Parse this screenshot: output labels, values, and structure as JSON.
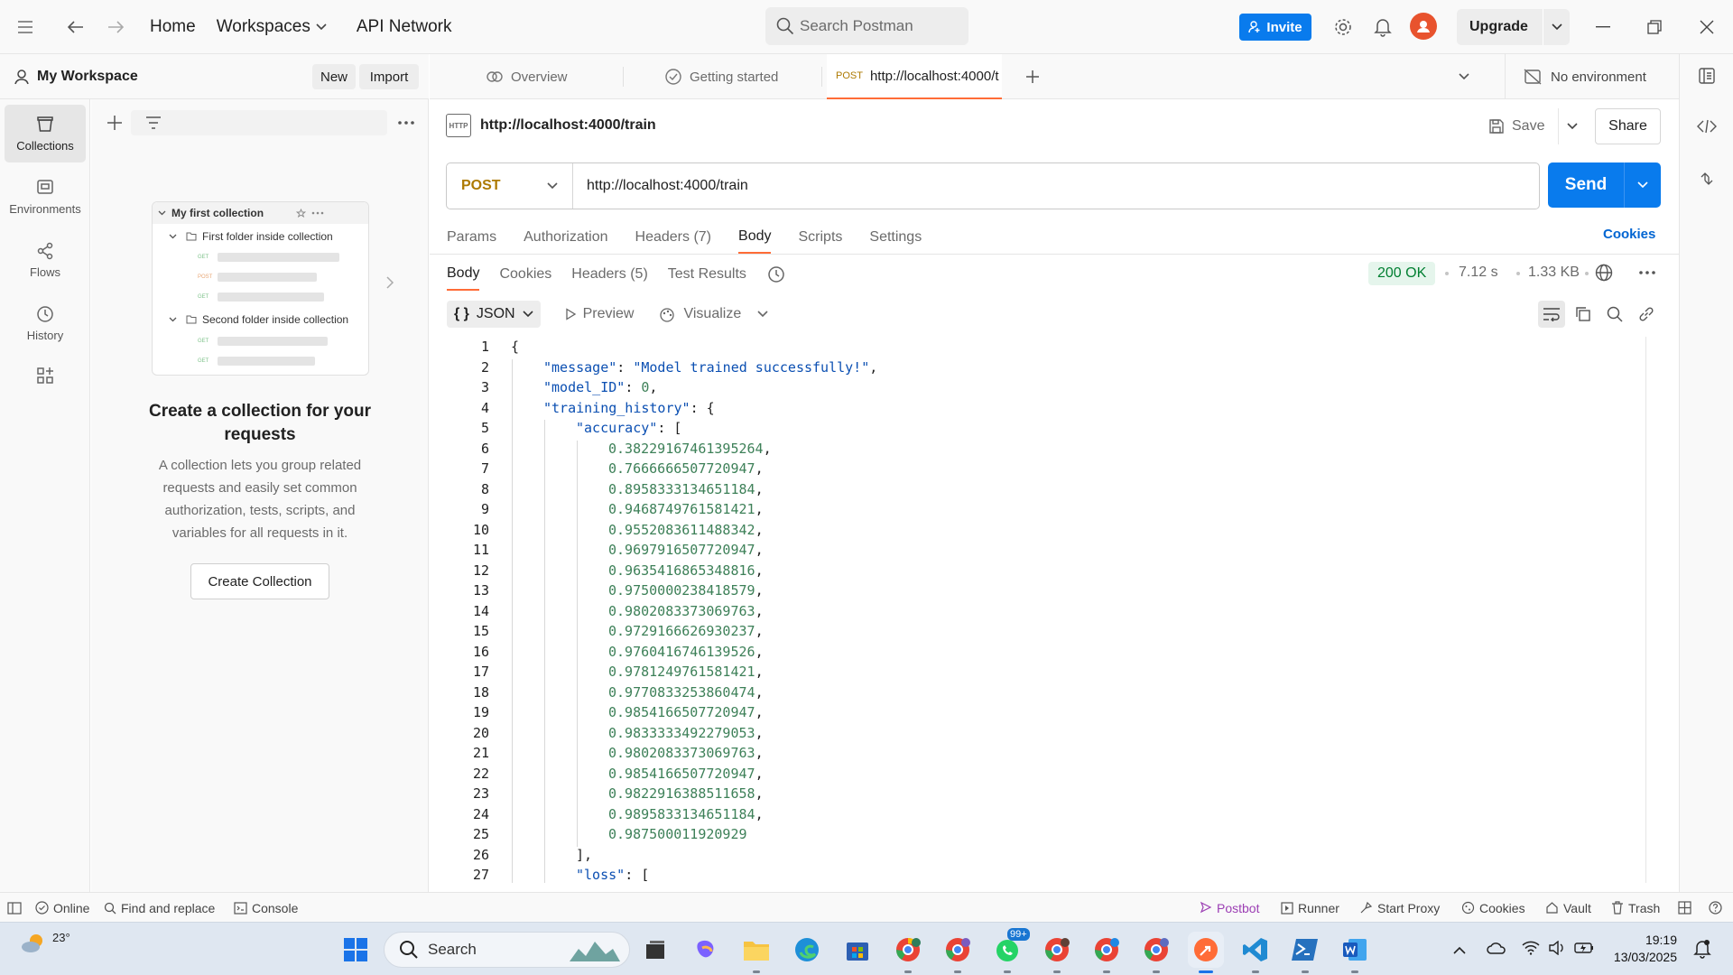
{
  "topbar": {
    "home": "Home",
    "workspaces": "Workspaces",
    "api_network": "API Network",
    "search_placeholder": "Search Postman",
    "invite": "Invite",
    "upgrade": "Upgrade"
  },
  "rail": {
    "items": [
      {
        "label": "Collections",
        "icon": "collections-icon"
      },
      {
        "label": "Environments",
        "icon": "environments-icon"
      },
      {
        "label": "Flows",
        "icon": "flows-icon"
      },
      {
        "label": "History",
        "icon": "history-icon"
      }
    ]
  },
  "sidebar": {
    "workspace_name": "My Workspace",
    "new": "New",
    "import": "Import",
    "illustration": {
      "collection": "My first collection",
      "folder1": "First folder inside collection",
      "folder2": "Second folder inside collection",
      "methods": [
        "GET",
        "POST",
        "GET",
        "GET",
        "GET"
      ]
    },
    "empty_title": "Create a collection for your requests",
    "empty_desc": "A collection lets you group related requests and easily set common authorization, tests, scripts, and variables for all requests in it.",
    "create_button": "Create Collection"
  },
  "tabs": {
    "overview": "Overview",
    "getting_started": "Getting started",
    "active_method": "POST",
    "active_url": "http://localhost:4000/t",
    "environment": "No environment"
  },
  "request": {
    "title": "http://localhost:4000/train",
    "badge": "HTTP",
    "save": "Save",
    "share": "Share",
    "method": "POST",
    "url": "http://localhost:4000/train",
    "send": "Send",
    "tabs": [
      "Params",
      "Authorization",
      "Headers",
      "Body",
      "Scripts",
      "Settings"
    ],
    "headers_count": "(7)",
    "cookies": "Cookies"
  },
  "response": {
    "tabs": [
      "Body",
      "Cookies",
      "Headers",
      "Test Results"
    ],
    "headers_count": "(5)",
    "status": "200 OK",
    "time": "7.12 s",
    "size": "1.33 KB",
    "format": "JSON",
    "preview": "Preview",
    "visualize": "Visualize",
    "lines": [
      {
        "n": "1",
        "t": "{"
      },
      {
        "n": "2",
        "key": "\"message\"",
        "val": "\"Model trained successfully!\"",
        "tail": ","
      },
      {
        "n": "3",
        "key": "\"model_ID\"",
        "num": "0",
        "tail": ","
      },
      {
        "n": "4",
        "key": "\"training_history\"",
        "tail": ": {"
      },
      {
        "n": "5",
        "key": "\"accuracy\"",
        "tail": ": ["
      },
      {
        "n": "6",
        "num": "0.38229167461395264",
        "tail": ","
      },
      {
        "n": "7",
        "num": "0.7666666507720947",
        "tail": ","
      },
      {
        "n": "8",
        "num": "0.8958333134651184",
        "tail": ","
      },
      {
        "n": "9",
        "num": "0.9468749761581421",
        "tail": ","
      },
      {
        "n": "10",
        "num": "0.9552083611488342",
        "tail": ","
      },
      {
        "n": "11",
        "num": "0.9697916507720947",
        "tail": ","
      },
      {
        "n": "12",
        "num": "0.9635416865348816",
        "tail": ","
      },
      {
        "n": "13",
        "num": "0.9750000238418579",
        "tail": ","
      },
      {
        "n": "14",
        "num": "0.9802083373069763",
        "tail": ","
      },
      {
        "n": "15",
        "num": "0.9729166626930237",
        "tail": ","
      },
      {
        "n": "16",
        "num": "0.9760416746139526",
        "tail": ","
      },
      {
        "n": "17",
        "num": "0.9781249761581421",
        "tail": ","
      },
      {
        "n": "18",
        "num": "0.9770833253860474",
        "tail": ","
      },
      {
        "n": "19",
        "num": "0.9854166507720947",
        "tail": ","
      },
      {
        "n": "20",
        "num": "0.9833333492279053",
        "tail": ","
      },
      {
        "n": "21",
        "num": "0.9802083373069763",
        "tail": ","
      },
      {
        "n": "22",
        "num": "0.9854166507720947",
        "tail": ","
      },
      {
        "n": "23",
        "num": "0.9822916388511658",
        "tail": ","
      },
      {
        "n": "24",
        "num": "0.9895833134651184",
        "tail": ","
      },
      {
        "n": "25",
        "num": "0.987500011920929",
        "tail": ""
      },
      {
        "n": "26",
        "t": "],"
      },
      {
        "n": "27",
        "key": "\"loss\"",
        "tail": ": ["
      }
    ]
  },
  "statusbar": {
    "online": "Online",
    "find_replace": "Find and replace",
    "console": "Console",
    "postbot": "Postbot",
    "runner": "Runner",
    "start_proxy": "Start Proxy",
    "cookies": "Cookies",
    "vault": "Vault",
    "trash": "Trash"
  },
  "taskbar": {
    "weather": "23°",
    "search": "Search",
    "badge": "99+",
    "time": "19:19",
    "date": "13/03/2025"
  },
  "colors": {
    "accent": "#ff6c37",
    "primary_blue": "#097bed",
    "method_post": "#ad7a03",
    "status_ok": "#007f31"
  }
}
